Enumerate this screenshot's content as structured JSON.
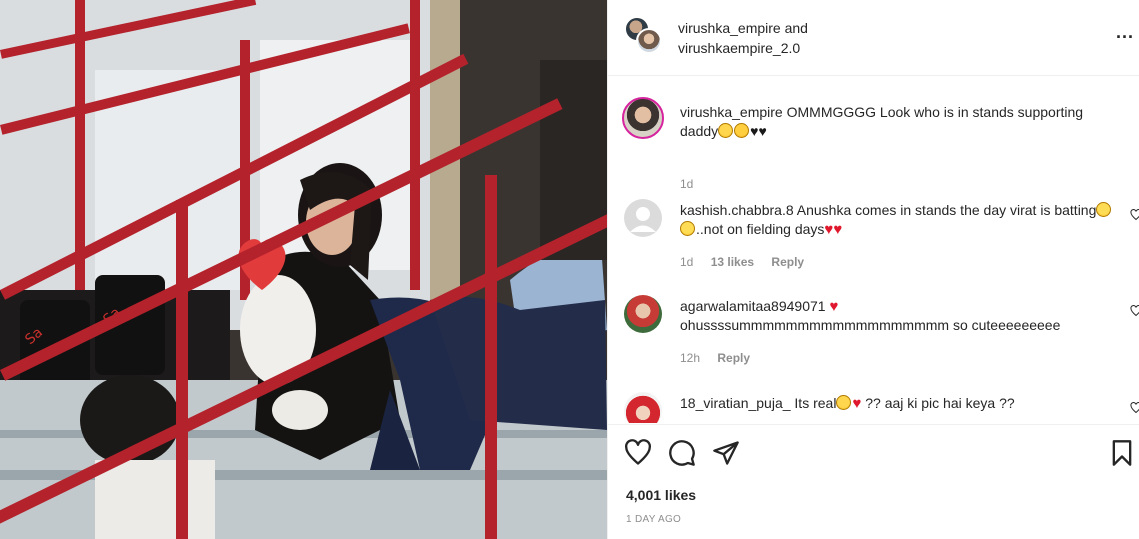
{
  "header": {
    "user1": "virushka_empire",
    "joiner": "and",
    "user2": "virushkaempire_2.0",
    "more_label": "..."
  },
  "caption": {
    "username": "virushka_empire",
    "text": "OMMMGGGG Look who is in stands supporting daddy",
    "time": "1d"
  },
  "comments": [
    {
      "username": "kashish.chabbra.8",
      "text_a": "Anushka comes in stands the day virat is batting",
      "text_b": "..not on fielding days",
      "time": "1d",
      "likes": "13 likes",
      "reply": "Reply"
    },
    {
      "username": "agarwalamitaa8949071",
      "text": "ohussssummmmmmmmmmmmmmmmmm so cuteeeeeeeee",
      "time": "12h",
      "reply": "Reply"
    },
    {
      "username": "18_viratian_puja_",
      "text_a": "Its real",
      "text_b": "?? aaj ki pic hai keya ??"
    }
  ],
  "post": {
    "likes": "4,001 likes",
    "posted": "1 DAY AGO"
  },
  "colors": {
    "heart_red": "#e0182d",
    "text_primary": "#262626",
    "text_secondary": "#8e8e8e",
    "stadium_rail": "#b4222c"
  }
}
